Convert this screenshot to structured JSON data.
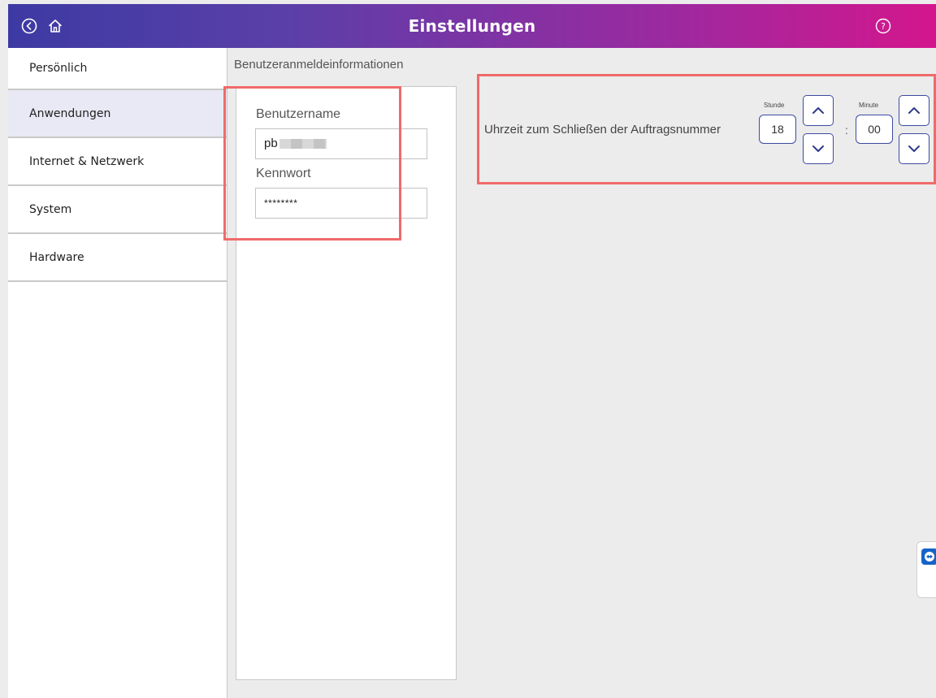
{
  "header": {
    "title": "Einstellungen"
  },
  "sidebar": {
    "items": [
      {
        "label": "Persönlich"
      },
      {
        "label": "Anwendungen"
      },
      {
        "label": "Internet & Netzwerk"
      },
      {
        "label": "System"
      },
      {
        "label": "Hardware"
      }
    ],
    "active_index": 1
  },
  "credentials": {
    "section_title": "Benutzeranmeldeinformationen",
    "username_label": "Benutzername",
    "username_value": "pb",
    "password_label": "Kennwort",
    "password_value": "********"
  },
  "job_close_time": {
    "label": "Uhrzeit zum Schließen der Auftragsnummer",
    "hour_label": "Stunde",
    "hour_value": "18",
    "minute_label": "Minute",
    "minute_value": "00",
    "separator": ":"
  },
  "colors": {
    "header_gradient_start": "#3d3aa3",
    "header_gradient_end": "#d4168d",
    "highlight": "#f06a6a",
    "stepper_border": "#3d4aa0",
    "active_sidebar_bg": "#e8e9f4"
  },
  "icons": {
    "back": "back-circle-icon",
    "home": "home-icon",
    "help": "help-circle-icon",
    "up": "chevron-up-icon",
    "down": "chevron-down-icon",
    "remote": "teamviewer-icon"
  }
}
